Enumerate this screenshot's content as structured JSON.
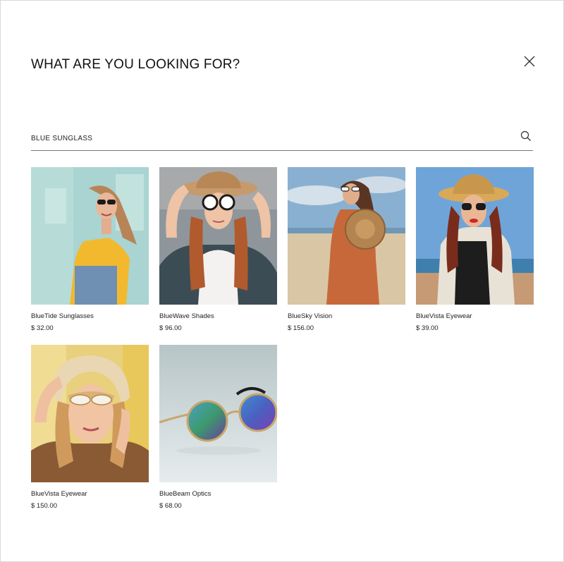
{
  "modal": {
    "title": "WHAT ARE YOU LOOKING FOR?",
    "close_icon": "close-icon"
  },
  "search": {
    "value": "BLUE SUNGLASS",
    "icon": "search-icon"
  },
  "products": [
    {
      "name": "BlueTide Sunglasses",
      "price": "$ 32.00"
    },
    {
      "name": "BlueWave Shades",
      "price": "$ 96.00"
    },
    {
      "name": "BlueSky Vision",
      "price": "$ 156.00"
    },
    {
      "name": "BlueVista Eyewear",
      "price": "$ 39.00"
    },
    {
      "name": "BlueVista Eyewear",
      "price": "$ 150.00"
    },
    {
      "name": "BlueBeam Optics",
      "price": "$ 68.00"
    }
  ]
}
